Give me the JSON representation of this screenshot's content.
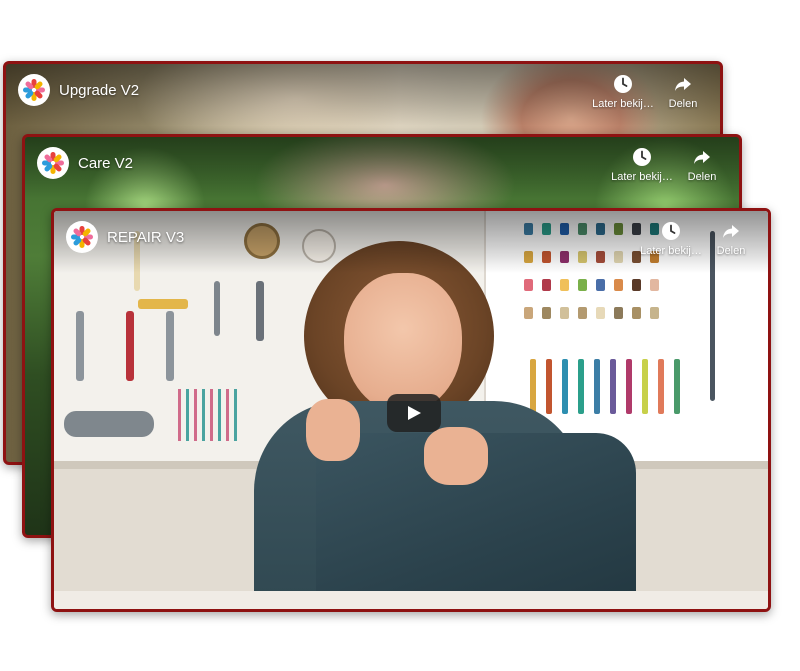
{
  "videos": [
    {
      "title": "Upgrade V2",
      "later_label": "Later bekij…",
      "share_label": "Delen"
    },
    {
      "title": "Care V2",
      "later_label": "Later bekij…",
      "share_label": "Delen"
    },
    {
      "title": "REPAIR V3",
      "later_label": "Later bekij…",
      "share_label": "Delen"
    }
  ],
  "colors": {
    "frame_border": "#8e1212",
    "logo_petals": [
      "#e8413c",
      "#f4b400",
      "#2d9cdb",
      "#ef6c9a"
    ]
  },
  "icons": {
    "logo": "brand-star-logo",
    "later": "clock-icon",
    "share": "share-arrow-icon",
    "play": "play-icon"
  }
}
